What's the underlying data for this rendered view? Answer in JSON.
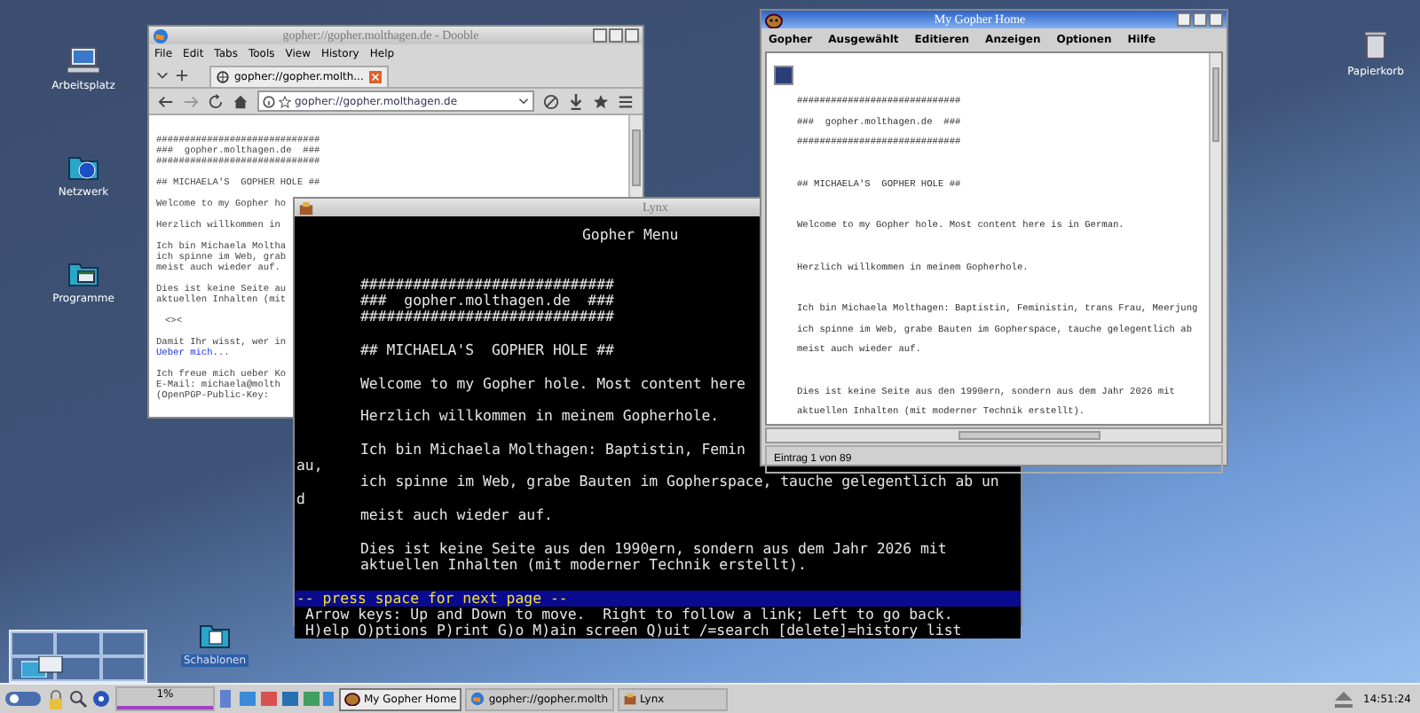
{
  "desktop_icons": [
    {
      "label": "Arbeitsplatz",
      "kind": "computer"
    },
    {
      "label": "Netzwerk",
      "kind": "network"
    },
    {
      "label": "Programme",
      "kind": "programs"
    },
    {
      "label": "Papierkorb",
      "kind": "trash"
    },
    {
      "label": "Schablonen",
      "kind": "templates"
    }
  ],
  "browser_window": {
    "title": "gopher://gopher.molthagen.de - Dooble",
    "active": false,
    "menu": [
      "File",
      "Edit",
      "Tabs",
      "Tools",
      "View",
      "History",
      "Help"
    ],
    "tab": "gopher://gopher.molth...",
    "address": "gopher://gopher.molthagen.de",
    "paragraphs": [
      [
        {
          "text": "#############################",
          "kind": "text"
        },
        {
          "text": "###  gopher.molthagen.de  ###",
          "kind": "text"
        },
        {
          "text": "#############################",
          "kind": "text"
        }
      ],
      [
        {
          "text": "## MICHAELA'S  GOPHER HOLE ##",
          "kind": "text"
        }
      ],
      [
        {
          "text": "Welcome to my Gopher ho",
          "kind": "text"
        }
      ],
      [
        {
          "text": "Herzlich willkommen in",
          "kind": "text"
        }
      ],
      [
        {
          "text": "Ich bin Michaela Moltha",
          "kind": "text"
        },
        {
          "text": "ich spinne im Web, grab",
          "kind": "text"
        },
        {
          "text": "meist auch wieder auf.",
          "kind": "text"
        }
      ],
      [
        {
          "text": "Dies ist keine Seite au",
          "kind": "text"
        },
        {
          "text": "aktuellen Inhalten (mit",
          "kind": "text"
        }
      ],
      [
        {
          "text": "<><",
          "kind": "ornament"
        }
      ],
      [
        {
          "text": "Damit Ihr wisst, wer in",
          "kind": "text"
        },
        {
          "text": "Ueber mich...",
          "kind": "link"
        }
      ],
      [
        {
          "text": "Ich freue mich ueber Ko",
          "kind": "text"
        },
        {
          "text": "E-Mail: michaela@molth",
          "kind": "text"
        },
        {
          "text": "(OpenPGP-Public-Key:",
          "kind": "text"
        }
      ]
    ]
  },
  "gopher_window": {
    "title": "My Gopher Home",
    "active": true,
    "menu": [
      "Gopher",
      "Ausgewählt",
      "Editieren",
      "Anzeigen",
      "Optionen",
      "Hilfe"
    ],
    "paragraphs": [
      [
        "#############################",
        "###  gopher.molthagen.de  ###",
        "#############################"
      ],
      [
        "## MICHAELA'S  GOPHER HOLE ##"
      ],
      [
        "Welcome to my Gopher hole. Most content here is in German."
      ],
      [
        "Herzlich willkommen in meinem Gopherhole."
      ],
      [
        "Ich bin Michaela Molthagen: Baptistin, Feministin, trans Frau, Meerjung",
        "ich spinne im Web, grabe Bauten im Gopherspace, tauche gelegentlich ab",
        "meist auch wieder auf."
      ],
      [
        "Dies ist keine Seite aus den 1990ern, sondern aus dem Jahr 2026 mit",
        "aktuellen Inhalten (mit moderner Technik erstellt)."
      ]
    ],
    "status": "Eintrag 1 von 89"
  },
  "lynx_window": {
    "title": "Lynx",
    "active": false,
    "heading": "Gopher Menu",
    "paragraphs": [
      [
        {
          "text": "#############################"
        },
        {
          "text": "###  gopher.molthagen.de  ###"
        },
        {
          "text": "#############################"
        }
      ],
      [
        {
          "text": "## MICHAELA'S  GOPHER HOLE ##"
        }
      ],
      [
        {
          "text": "Welcome to my Gopher hole. Most content here"
        }
      ],
      [
        {
          "text": "Herzlich willkommen in meinem Gopherhole."
        }
      ],
      [
        {
          "text": "Ich bin Michaela Molthagen: Baptistin, Femin",
          "wrap_rest": "au,"
        },
        {
          "text": "ich spinne im Web, grabe Bauten im Gopherspace, tauche gelegentlich ab un",
          "wrap_rest": "d"
        },
        {
          "text": "meist auch wieder auf."
        }
      ],
      [
        {
          "text": "Dies ist keine Seite aus den 1990ern, sondern aus dem Jahr 2026 mit"
        },
        {
          "text": "aktuellen Inhalten (mit moderner Technik erstellt)."
        }
      ]
    ],
    "prompt": "-- press space for next page --",
    "help": [
      "Arrow keys: Up and Down to move.  Right to follow a link; Left to go back.",
      "H)elp O)ptions P)rint G)o M)ain screen Q)uit /=search [delete]=history list"
    ]
  },
  "taskbar": {
    "cpu": "1%",
    "tasks": [
      {
        "label": "My Gopher Home",
        "kind": "gopher",
        "selected": true
      },
      {
        "label": "gopher://gopher.molth",
        "kind": "browser",
        "selected": false
      },
      {
        "label": "Lynx",
        "kind": "lynx",
        "selected": false
      }
    ],
    "clock": "14:51:24"
  }
}
